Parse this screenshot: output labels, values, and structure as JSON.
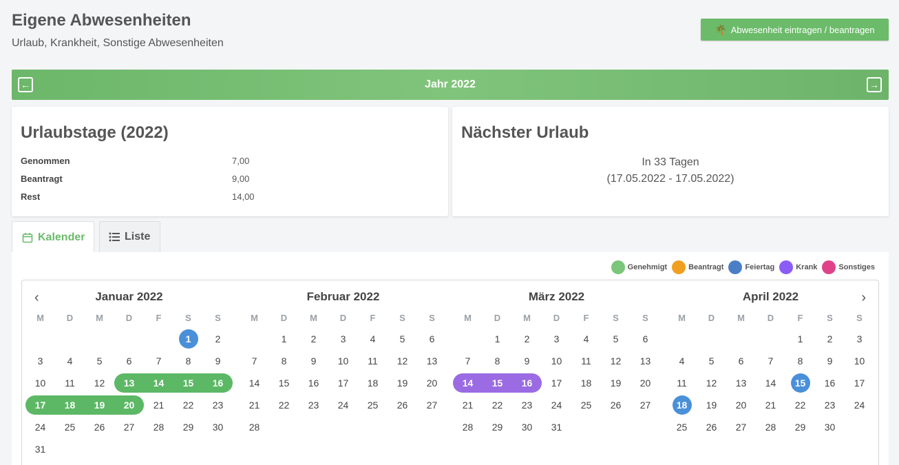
{
  "header": {
    "title": "Eigene Abwesenheiten",
    "subtitle": "Urlaub, Krankheit, Sonstige Abwesenheiten",
    "add_button_label": "Abwesenheit eintragen / beantragen"
  },
  "year_bar": {
    "label": "Jahr 2022"
  },
  "vacation_card": {
    "title": "Urlaubstage (2022)",
    "rows": [
      {
        "label": "Genommen",
        "value": "7,00"
      },
      {
        "label": "Beantragt",
        "value": "9,00"
      },
      {
        "label": "Rest",
        "value": "14,00"
      }
    ]
  },
  "next_vacation": {
    "title": "Nächster Urlaub",
    "line1": "In 33 Tagen",
    "line2": "(17.05.2022 - 17.05.2022)"
  },
  "tabs": [
    {
      "label": "Kalender",
      "active": true
    },
    {
      "label": "Liste",
      "active": false
    }
  ],
  "legend": [
    {
      "label": "Genehmigt",
      "color": "#7bc67a"
    },
    {
      "label": "Beantragt",
      "color": "#f0a020"
    },
    {
      "label": "Feiertag",
      "color": "#4a7fc8"
    },
    {
      "label": "Krank",
      "color": "#8b5cf6"
    },
    {
      "label": "Sonstiges",
      "color": "#e0428a"
    }
  ],
  "weekdays": [
    "M",
    "D",
    "M",
    "D",
    "F",
    "S",
    "S"
  ],
  "months": [
    {
      "title": "Januar 2022",
      "offset": 5,
      "days": 31,
      "holidays": [
        1
      ],
      "approved": [
        13,
        14,
        15,
        16,
        17,
        18,
        19,
        20
      ],
      "sick": []
    },
    {
      "title": "Februar 2022",
      "offset": 1,
      "days": 28,
      "holidays": [],
      "approved": [],
      "sick": []
    },
    {
      "title": "März 2022",
      "offset": 1,
      "days": 31,
      "holidays": [],
      "approved": [],
      "sick": [
        14,
        15,
        16
      ]
    },
    {
      "title": "April 2022",
      "offset": 4,
      "days": 30,
      "holidays": [
        15,
        18
      ],
      "approved": [],
      "sick": []
    }
  ],
  "colors": {
    "approved": "#5cb865",
    "sick": "#9b6be3",
    "holiday": "#4a90d9",
    "accent": "#6cbb6a"
  }
}
